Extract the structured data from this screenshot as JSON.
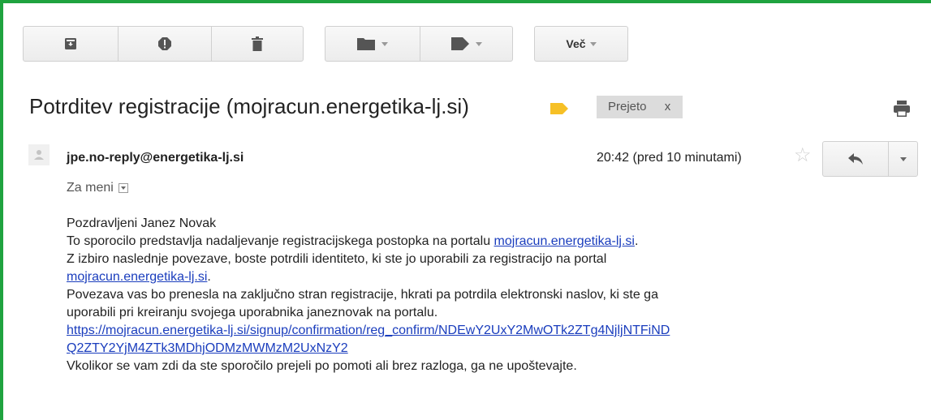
{
  "toolbar": {
    "more_label": "Več"
  },
  "subject": {
    "title": "Potrditev registracije (mojracun.energetika-lj.si)",
    "label_chip": "Prejeto",
    "label_chip_close": "x"
  },
  "message": {
    "sender": "jpe.no-reply@energetika-lj.si",
    "timestamp": "20:42 (pred 10 minutami)",
    "recipient_label": "Za meni",
    "body": {
      "greeting": "Pozdravljeni Janez Novak",
      "line1_prefix": "To sporocilo predstavlja nadaljevanje registracijskega postopka na portalu ",
      "line1_link": "mojracun.energetika-lj.si",
      "line1_suffix": ".",
      "line2": "Z izbiro naslednje povezave, boste potrdili identiteto, ki ste jo uporabili za registracijo na portal",
      "line3_link": "mojracun.energetika-lj.si",
      "line3_suffix": ".",
      "line4": "Povezava vas bo prenesla na zaključno stran registracije, hkrati pa potrdila elektronski naslov, ki ste ga",
      "line5": "uporabili pri kreiranju svojega uporabnika janeznovak na portalu.",
      "confirm_link_part1": "https://mojracun.energetika-lj.si/signup/confirmation/reg_confirm/NDEwY2UxY2MwOTk2ZTg4NjljNTFiND",
      "confirm_link_part2": "Q2ZTY2YjM4ZTk3MDhjODMzMWMzM2UxNzY2",
      "closing": "Vkolikor se vam zdi da ste sporočilo prejeli po pomoti ali brez razloga, ga ne upoštevajte."
    }
  },
  "icons": {
    "archive": "archive-icon",
    "spam": "report-spam-icon",
    "delete": "trash-icon",
    "move": "folder-icon",
    "labels": "label-tag-icon",
    "important": "important-marker-icon",
    "print": "print-icon",
    "avatar": "person-avatar-icon",
    "star": "star-icon",
    "reply": "reply-icon",
    "more": "chevron-down-icon"
  },
  "colors": {
    "frame": "#1fa33f",
    "link": "#1a3dbd",
    "important_marker": "#f6c026",
    "chip_bg": "#dcdcdc"
  }
}
